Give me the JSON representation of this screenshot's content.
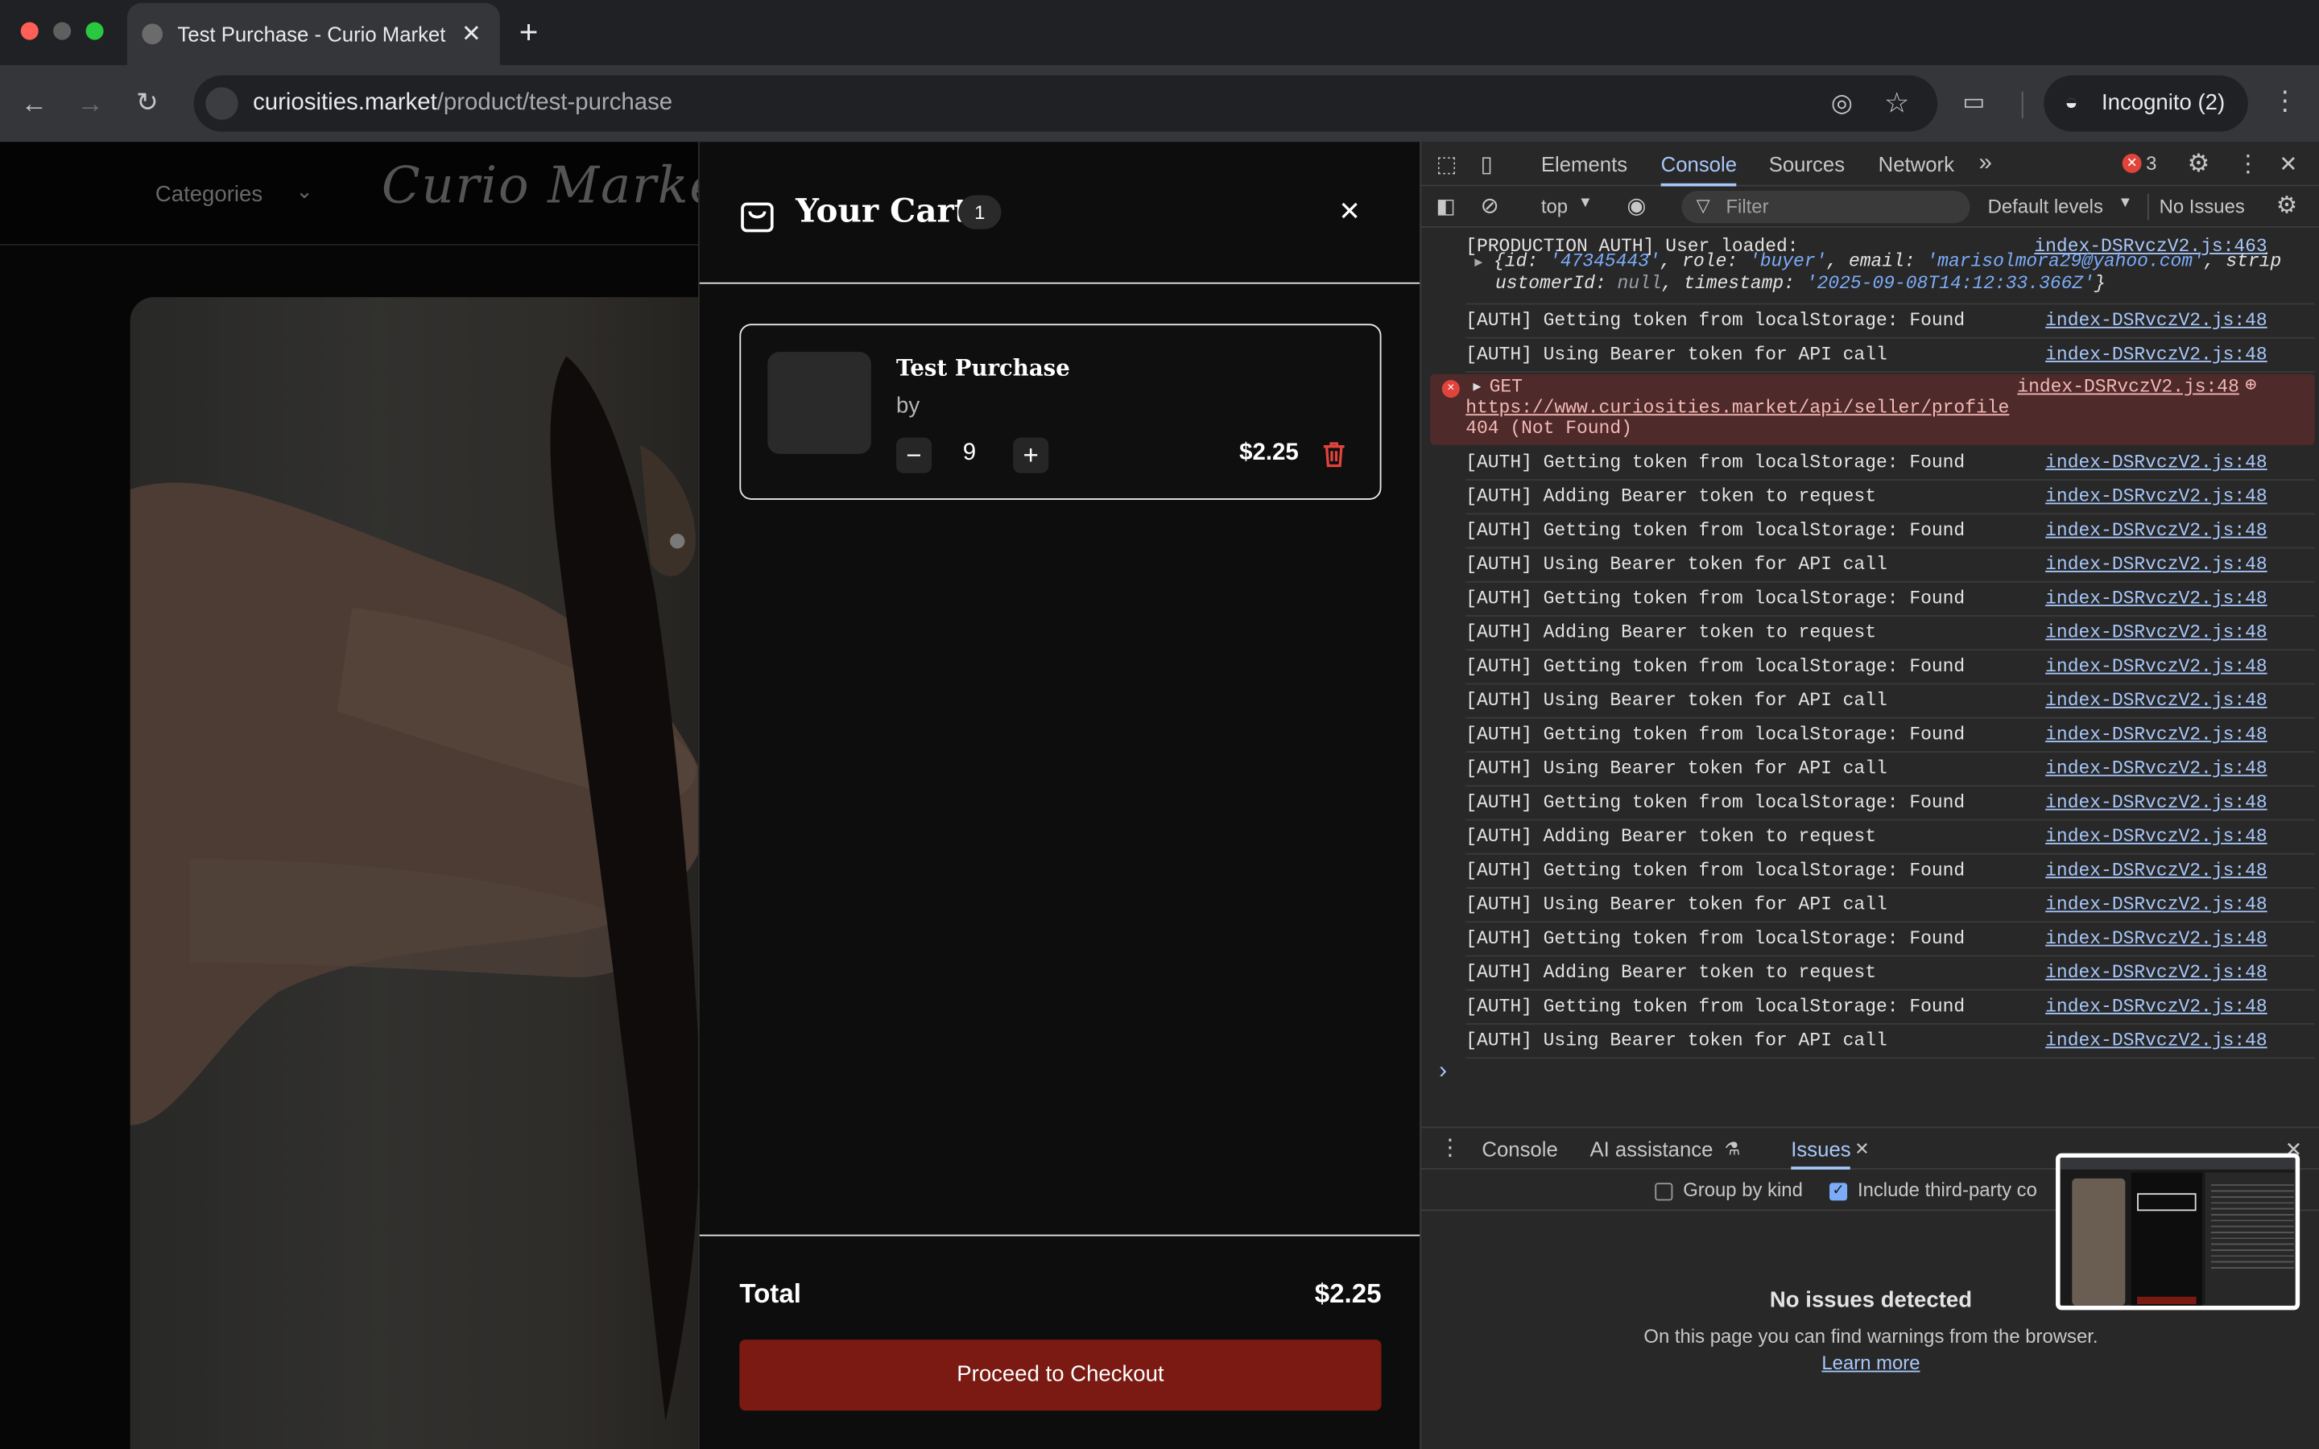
{
  "browser": {
    "tab_title": "Test Purchase - Curio Market",
    "new_tab": "+",
    "url_domain": "curiosities.market",
    "url_path": "/product/test-purchase",
    "incognito_label": "Incognito (2)"
  },
  "site": {
    "categories_label": "Categories",
    "logo_text": "Curio Market"
  },
  "cart": {
    "title": "Your Cart",
    "count_badge": "1",
    "item": {
      "name": "Test Purchase",
      "by": "by",
      "quantity": "9",
      "price": "$2.25",
      "qty_minus": "−",
      "qty_plus": "+"
    },
    "total_label": "Total",
    "total_value": "$2.25",
    "checkout_label": "Proceed to Checkout"
  },
  "devtools": {
    "tabs": [
      "Elements",
      "Console",
      "Sources",
      "Network"
    ],
    "more_tabs": "»",
    "error_count": "3",
    "context": "top",
    "filter_placeholder": "Filter",
    "levels": "Default levels",
    "issues_status": "No Issues",
    "logs": [
      {
        "text": "[PRODUCTION AUTH] User loaded:",
        "src": "index-DSRvczV2.js:463"
      },
      {
        "text": "[AUTH] Getting token from localStorage: Found",
        "src": "index-DSRvczV2.js:48"
      },
      {
        "text": "[AUTH] Using Bearer token for API call",
        "src": "index-DSRvczV2.js:48"
      },
      {
        "text": "[AUTH] Getting token from localStorage: Found",
        "src": "index-DSRvczV2.js:48"
      },
      {
        "text": "[AUTH] Adding Bearer token to request",
        "src": "index-DSRvczV2.js:48"
      },
      {
        "text": "[AUTH] Getting token from localStorage: Found",
        "src": "index-DSRvczV2.js:48"
      },
      {
        "text": "[AUTH] Using Bearer token for API call",
        "src": "index-DSRvczV2.js:48"
      },
      {
        "text": "[AUTH] Getting token from localStorage: Found",
        "src": "index-DSRvczV2.js:48"
      },
      {
        "text": "[AUTH] Adding Bearer token to request",
        "src": "index-DSRvczV2.js:48"
      },
      {
        "text": "[AUTH] Getting token from localStorage: Found",
        "src": "index-DSRvczV2.js:48"
      },
      {
        "text": "[AUTH] Using Bearer token for API call",
        "src": "index-DSRvczV2.js:48"
      },
      {
        "text": "[AUTH] Getting token from localStorage: Found",
        "src": "index-DSRvczV2.js:48"
      },
      {
        "text": "[AUTH] Using Bearer token for API call",
        "src": "index-DSRvczV2.js:48"
      },
      {
        "text": "[AUTH] Getting token from localStorage: Found",
        "src": "index-DSRvczV2.js:48"
      },
      {
        "text": "[AUTH] Adding Bearer token to request",
        "src": "index-DSRvczV2.js:48"
      },
      {
        "text": "[AUTH] Getting token from localStorage: Found",
        "src": "index-DSRvczV2.js:48"
      },
      {
        "text": "[AUTH] Using Bearer token for API call",
        "src": "index-DSRvczV2.js:48"
      },
      {
        "text": "[AUTH] Getting token from localStorage: Found",
        "src": "index-DSRvczV2.js:48"
      },
      {
        "text": "[AUTH] Adding Bearer token to request",
        "src": "index-DSRvczV2.js:48"
      },
      {
        "text": "[AUTH] Getting token from localStorage: Found",
        "src": "index-DSRvczV2.js:48"
      },
      {
        "text": "[AUTH] Using Bearer token for API call",
        "src": "index-DSRvczV2.js:48"
      }
    ],
    "user_object": {
      "line1_prefix": "{",
      "id_key": "id: ",
      "id_val": "'47345443'",
      "role_key": ", role: ",
      "role_val": "'buyer'",
      "email_key": ", email: ",
      "email_val": "'marisolmora29@yahoo.com'",
      "stripe_key": ", stripeC",
      "line2_key": "ustomerId: ",
      "line2_null": "null",
      "ts_key": ", timestamp: ",
      "ts_val": "'2025-09-08T14:12:33.366Z'",
      "line2_suffix": "}"
    },
    "error": {
      "method": "GET",
      "url": "https://www.curiosities.market/api/seller/profile",
      "status": "404 (Not Found)",
      "src": "index-DSRvczV2.js:48"
    },
    "prompt": "›",
    "drawer_tabs": [
      "Console",
      "AI assistance",
      "Issues"
    ],
    "group_by_kind": "Group by kind",
    "include_third_party": "Include third-party co",
    "no_issues_title": "No issues detected",
    "no_issues_desc": "On this page you can find warnings from the browser.",
    "learn_more": "Learn more"
  },
  "colors": {
    "checkout_bg": "#7a1a13",
    "delete_icon": "#e0443a",
    "error_row_bg": "#4e2a2a",
    "link_blue": "#a8c7fa"
  }
}
